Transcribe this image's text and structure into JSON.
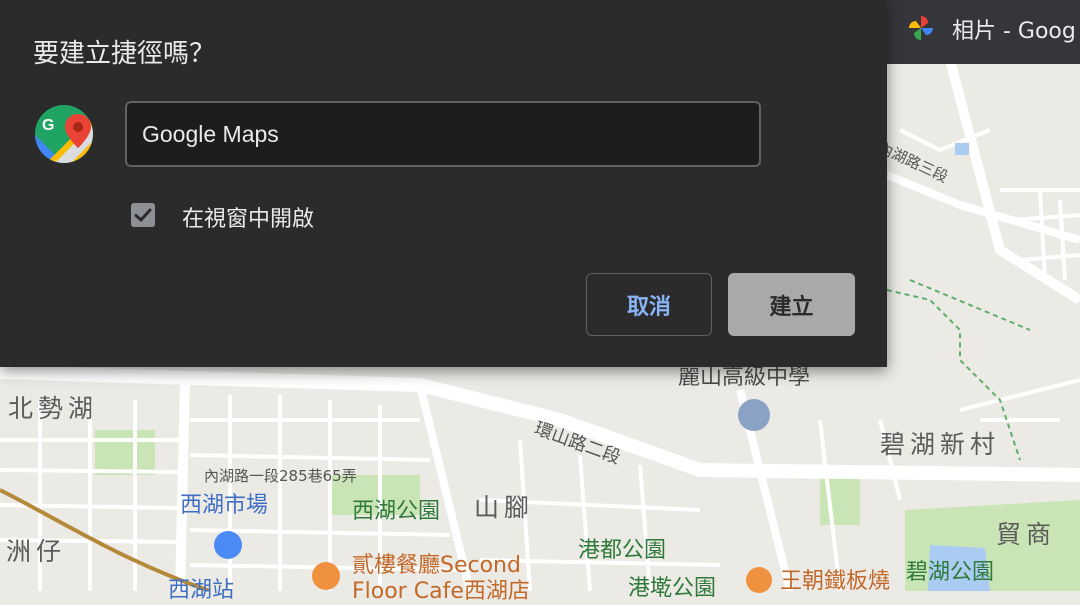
{
  "dialog": {
    "title": "要建立捷徑嗎？",
    "name_value": "Google Maps",
    "open_in_window_label": "在視窗中開啟",
    "open_in_window_checked": true,
    "cancel_label": "取消",
    "create_label": "建立",
    "app_icon": "google-maps-icon"
  },
  "browser_tab": {
    "title": "相片 - Goog",
    "icon": "google-photos-icon"
  },
  "map": {
    "labels": {
      "road_neihu3": "內湖路三段",
      "school": "麗山高級中學",
      "district_beishi": "北勢湖",
      "road_huanshan": "環山路二段",
      "district_bihu": "碧湖新村",
      "road_neihu1": "內湖路一段285巷65弄",
      "poi_market": "西湖市場",
      "poi_park": "西湖公園",
      "district_shanjiao": "山腳",
      "district_maoshang": "貿商",
      "district_zhouzai": "洲仔",
      "poi_restaurant": "貳樓餐廳Second Floor Cafe西湖店",
      "poi_gangdu": "港都公園",
      "poi_bihu_park": "碧湖公園",
      "poi_gangqiao": "港墘公園",
      "poi_wangchao": "王朝鐵板燒",
      "poi_station": "西湖站"
    }
  }
}
